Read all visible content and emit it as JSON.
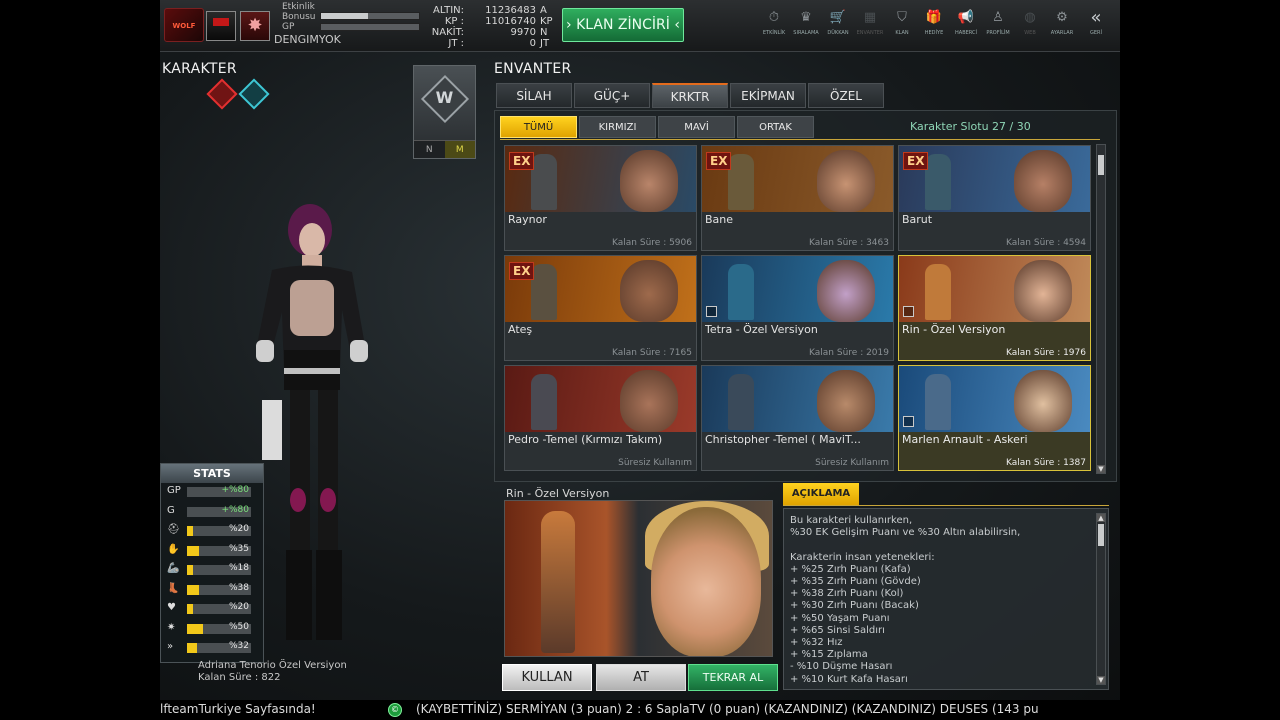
{
  "topbar": {
    "xp_labels": [
      "Etkinlik",
      "Bonusu",
      "GP"
    ],
    "xp_fill": [
      0.48,
      0.0
    ],
    "player_name": "DENGIMYOK",
    "currency_labels": [
      "ALTIN:",
      "KP :",
      "NAKİT:",
      "JT :"
    ],
    "currency_values": [
      "11236483",
      "11016740",
      "9970",
      "0"
    ],
    "currency_units": [
      "A",
      "KP",
      "N",
      "JT"
    ],
    "clan_button": "KLAN ZİNCİRİ",
    "nav": [
      {
        "label": "ETKİNLİK",
        "icon": "⏱"
      },
      {
        "label": "SIRALAMA",
        "icon": "♛"
      },
      {
        "label": "DÜKKAN",
        "icon": "🛒"
      },
      {
        "label": "ENVANTER",
        "icon": "▦"
      },
      {
        "label": "KLAN",
        "icon": "⛉"
      },
      {
        "label": "HEDİYE",
        "icon": "🎁"
      },
      {
        "label": "HABERCİ",
        "icon": "📢"
      },
      {
        "label": "PROFİLİM",
        "icon": "♙"
      },
      {
        "label": "WEB",
        "icon": "◍"
      },
      {
        "label": "AYARLAR",
        "icon": "⚙"
      }
    ],
    "back_label": "GERİ",
    "back_icon": "«"
  },
  "character": {
    "title": "KARAKTER",
    "emblem_modes": [
      "N",
      "M"
    ],
    "name": "Adriana Tenorio Özel Versiyon",
    "time": "Kalan Süre : 822"
  },
  "stats": {
    "title": "STATS",
    "rows": [
      {
        "icon": "GP",
        "value": "+%80",
        "fill": 0.0,
        "color": "#e7c61c"
      },
      {
        "icon": "G",
        "value": "+%80",
        "fill": 0.0,
        "color": "#e7c61c"
      },
      {
        "icon": "⛑",
        "value": "%20",
        "fill": 0.1,
        "color": "#f2c81a"
      },
      {
        "icon": "✋",
        "value": "%35",
        "fill": 0.18,
        "color": "#f2c81a"
      },
      {
        "icon": "🦾",
        "value": "%18",
        "fill": 0.09,
        "color": "#f2c81a"
      },
      {
        "icon": "👢",
        "value": "%38",
        "fill": 0.19,
        "color": "#f2c81a"
      },
      {
        "icon": "♥",
        "value": "%20",
        "fill": 0.1,
        "color": "#f2c81a"
      },
      {
        "icon": "✷",
        "value": "%50",
        "fill": 0.25,
        "color": "#f2c81a"
      },
      {
        "icon": "»",
        "value": "%32",
        "fill": 0.16,
        "color": "#f2c81a"
      }
    ]
  },
  "inventory": {
    "title": "ENVANTER",
    "tabs": [
      "SİLAH",
      "GÜÇ+",
      "KRKTR",
      "EKİPMAN",
      "ÖZEL"
    ],
    "active_tab": 2,
    "filters": [
      "TÜMÜ",
      "KIRMIZI",
      "MAVİ",
      "ORTAK"
    ],
    "active_filter": 0,
    "slot_label": "Karakter Slotu 27 / 30",
    "cards": [
      {
        "name": "Raynor",
        "time": "Kalan Süre : 5906",
        "ex": "EX",
        "bg": [
          "#5a2a10",
          "#2a4a66"
        ],
        "skin": "#b9856a",
        "soldier": "#4a4c4e",
        "selected": false,
        "checkbox": false
      },
      {
        "name": "Bane",
        "time": "Kalan Süre : 3463",
        "ex": "EX",
        "bg": [
          "#6a3a12",
          "#8a5a2a"
        ],
        "skin": "#c79373",
        "soldier": "#6a5a3a",
        "selected": false,
        "checkbox": false
      },
      {
        "name": "Barut",
        "time": "Kalan Süre : 4594",
        "ex": "EX",
        "bg": [
          "#2a3a5a",
          "#3a6a9a"
        ],
        "skin": "#b68066",
        "soldier": "#3a5a6a",
        "selected": false,
        "checkbox": false
      },
      {
        "name": "Ateş",
        "time": "Kalan Süre : 7165",
        "ex": "EX",
        "bg": [
          "#7a3a0a",
          "#c0701a"
        ],
        "skin": "#9e6a4c",
        "soldier": "#5a5040",
        "selected": false,
        "checkbox": false
      },
      {
        "name": "Tetra - Özel Versiyon",
        "time": "Kalan Süre : 2019",
        "ex": "",
        "bg": [
          "#1a3a5a",
          "#2a7aaa"
        ],
        "skin": "#c2a0c8",
        "soldier": "#2a6a8a",
        "selected": false,
        "checkbox": true
      },
      {
        "name": "Rin - Özel Versiyon",
        "time": "Kalan Süre : 1976",
        "ex": "",
        "bg": [
          "#8a3a1a",
          "#c08a5a"
        ],
        "skin": "#e2b496",
        "soldier": "#c07a3a",
        "selected": true,
        "checkbox": true
      },
      {
        "name": "Pedro -Temel (Kırmızı Takım)",
        "time": "Süresiz Kullanım",
        "ex": "",
        "bg": [
          "#5a1a14",
          "#9a3a2a"
        ],
        "skin": "#a9745a",
        "soldier": "#4a4a52",
        "selected": false,
        "checkbox": false
      },
      {
        "name": "Christopher -Temel ( MaviT...",
        "time": "Süresiz Kullanım",
        "ex": "",
        "bg": [
          "#1a3a5a",
          "#3a7aaa"
        ],
        "skin": "#b88a6a",
        "soldier": "#3a4a5a",
        "selected": false,
        "checkbox": false
      },
      {
        "name": "Marlen Arnault - Askeri",
        "time": "Kalan Süre : 1387",
        "ex": "",
        "bg": [
          "#1a4a7a",
          "#4a8ac0"
        ],
        "skin": "#e0c0a0",
        "soldier": "#4a6a8a",
        "selected": true,
        "checkbox": true
      }
    ]
  },
  "detail": {
    "title": "Rin - Özel Versiyon",
    "desc_tab": "AÇIKLAMA",
    "description": "Bu karakteri kullanırken,\n%30 EK Gelişim Puanı ve %30 Altın alabilirsin,\n\nKarakterin insan yetenekleri:\n+ %25 Zırh Puanı (Kafa)\n+ %35 Zırh Puanı (Gövde)\n+ %38 Zırh Puanı (Kol)\n+ %30 Zırh Puanı (Bacak)\n+ %50 Yaşam Puanı\n+ %65 Sinsi Saldırı\n+ %32 Hız\n+ %15 Zıplama\n- %10 Düşme Hasarı\n+ %10 Kurt Kafa Hasarı",
    "buttons": {
      "use": "KULLAN",
      "drop": "AT",
      "rebuy": "TEKRAR AL"
    }
  },
  "ticker": {
    "left": "lfteamTurkiye Sayfasında!",
    "icon": "©",
    "right": "(KAYBETTİNİZ) SERMİYAN (3 puan) 2 : 6 SaplaTV (0 puan) (KAZANDINIZ)      (KAZANDINIZ) DEUSES (143 pu"
  }
}
